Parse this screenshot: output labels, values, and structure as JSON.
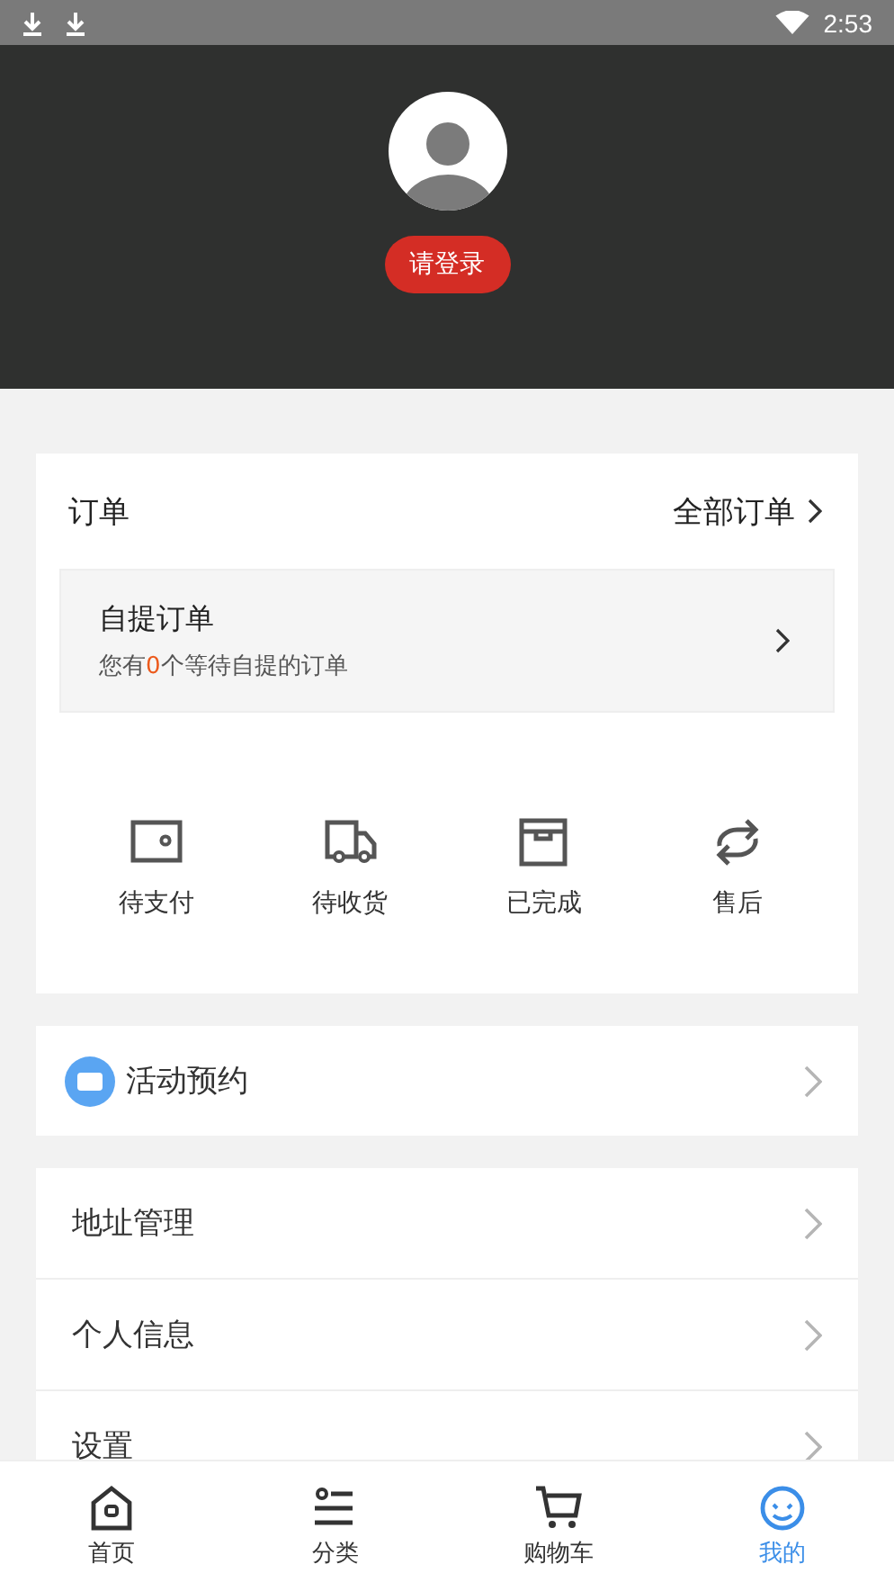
{
  "status_bar": {
    "time": "2:53"
  },
  "profile": {
    "login_button": "请登录"
  },
  "orders": {
    "title": "订单",
    "all_link": "全部订单",
    "pickup": {
      "title": "自提订单",
      "subtitle": "您有**0**个等待自提的订单"
    },
    "statuses": [
      {
        "kind": "wallet",
        "label": "待支付"
      },
      {
        "kind": "truck",
        "label": "待收货"
      },
      {
        "kind": "box",
        "label": "已完成"
      },
      {
        "kind": "cycle",
        "label": "售后"
      }
    ]
  },
  "activity": {
    "label": "活动预约"
  },
  "menu": [
    {
      "label": "地址管理"
    },
    {
      "label": "个人信息"
    },
    {
      "label": "设置"
    }
  ],
  "tabs": [
    {
      "kind": "home",
      "label": "首页",
      "selected": false
    },
    {
      "kind": "list",
      "label": "分类",
      "selected": false
    },
    {
      "kind": "cart",
      "label": "购物车",
      "selected": false
    },
    {
      "kind": "user",
      "label": "我的",
      "selected": true
    }
  ]
}
